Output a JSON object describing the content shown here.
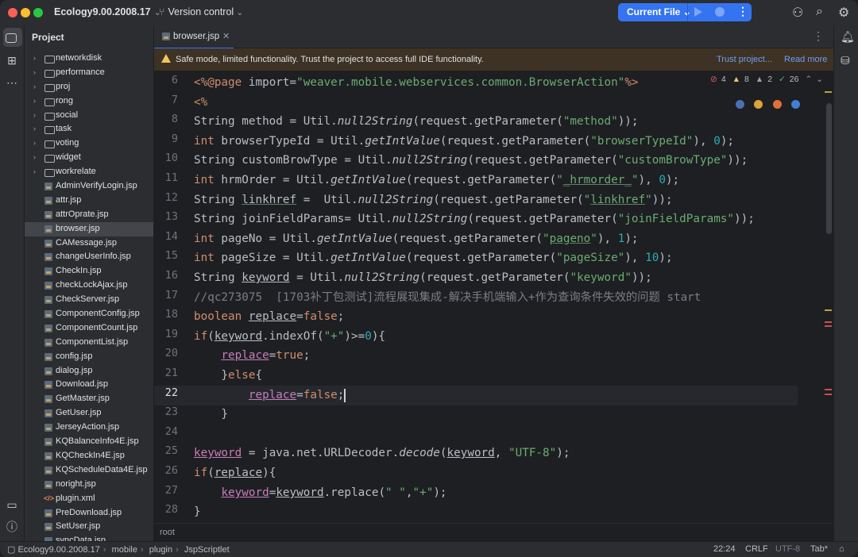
{
  "titlebar": {
    "project": "Ecology9.00.2008.17",
    "vcs": "Version control",
    "run_config": "Current File"
  },
  "project_panel": {
    "title": "Project",
    "folders": [
      "networkdisk",
      "performance",
      "proj",
      "rong",
      "social",
      "task",
      "voting",
      "widget",
      "workrelate"
    ],
    "files": [
      "AdminVerifyLogin.jsp",
      "attr.jsp",
      "attrOprate.jsp",
      "browser.jsp",
      "CAMessage.jsp",
      "changeUserInfo.jsp",
      "CheckIn.jsp",
      "checkLockAjax.jsp",
      "CheckServer.jsp",
      "ComponentConfig.jsp",
      "ComponentCount.jsp",
      "ComponentList.jsp",
      "config.jsp",
      "dialog.jsp",
      "Download.jsp",
      "GetMaster.jsp",
      "GetUser.jsp",
      "JerseyAction.jsp",
      "KQBalanceInfo4E.jsp",
      "KQCheckIn4E.jsp",
      "KQScheduleData4E.jsp",
      "noright.jsp",
      "plugin.xml",
      "PreDownload.jsp",
      "SetUser.jsp",
      "syncData.jsp"
    ],
    "selected": "browser.jsp"
  },
  "editor": {
    "tab_label": "browser.jsp",
    "banner_message": "Safe mode, limited functionality. Trust the project to access full IDE functionality.",
    "banner_trust": "Trust project...",
    "banner_read_more": "Read more",
    "inspections": {
      "errors": "4",
      "warnings": "8",
      "weak": "2",
      "ok": "26"
    },
    "line_numbers": [
      "6",
      "7",
      "8",
      "9",
      "10",
      "11",
      "12",
      "13",
      "14",
      "15",
      "16",
      "17",
      "18",
      "19",
      "20",
      "21",
      "22",
      "23",
      "24",
      "25",
      "26",
      "27",
      "28"
    ],
    "current_line": "22"
  },
  "breadcrumb": "root",
  "statusbar": {
    "path": [
      "Ecology9.00.2008.17",
      "mobile",
      "plugin",
      "JspScriptlet"
    ],
    "position": "22:24",
    "line_sep": "CRLF",
    "encoding": "UTF-8",
    "indent": "Tab*"
  },
  "colors": {
    "accent": "#3574f0",
    "keyword": "#cf8e6d",
    "string": "#6aab73",
    "number": "#2aacb8",
    "field": "#c77dbb"
  }
}
